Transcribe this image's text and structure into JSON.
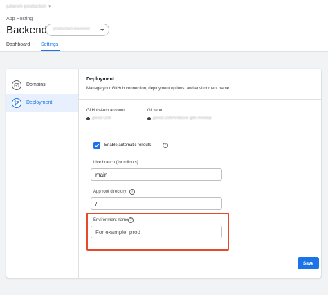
{
  "header": {
    "project": "julianeli-production",
    "section": "App Hosting",
    "title": "Backend",
    "backend_selector": "production-backend"
  },
  "tabs": [
    {
      "label": "Dashboard",
      "active": false
    },
    {
      "label": "Settings",
      "active": true
    }
  ],
  "sidebar": {
    "items": [
      {
        "label": "Domains",
        "icon": "domains-icon",
        "active": false
      },
      {
        "label": "Deployment",
        "icon": "branch-icon",
        "active": true
      }
    ]
  },
  "deployment": {
    "title": "Deployment",
    "description": "Manage your GitHub connection, deployment options, and environment name",
    "github_auth_label": "GitHub Auth account",
    "github_auth_value": "jpeez7296",
    "git_repo_label": "Git repo",
    "git_repo_value": "jpeez7296/firebase-gde-meetup",
    "auto_rollouts_label": "Enable automatic rollouts",
    "auto_rollouts_checked": true,
    "live_branch_label": "Live branch (for rollouts)",
    "live_branch_value": "main",
    "app_root_label": "App root directory",
    "app_root_value": "/",
    "env_name_label": "Environment name",
    "env_name_value": "",
    "env_name_placeholder": "For example, prod",
    "save_label": "Save"
  },
  "colors": {
    "accent": "#1a73e8",
    "highlight": "#e8492c",
    "background": "#f1f3f4"
  }
}
